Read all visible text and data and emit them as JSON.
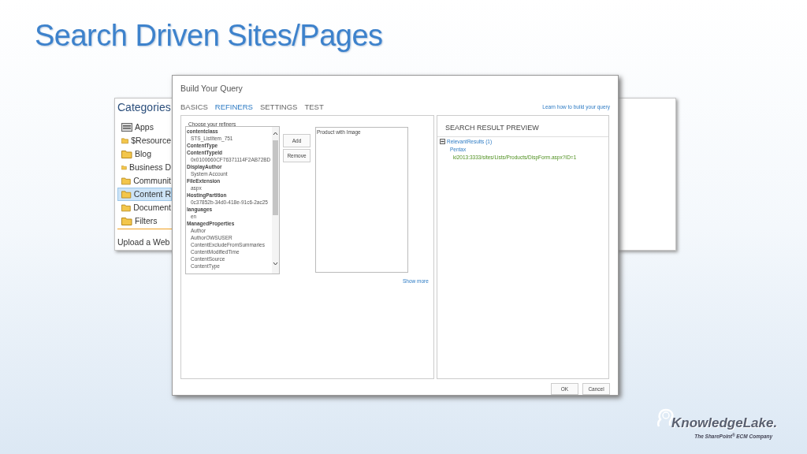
{
  "slide_title": "Search Driven Sites/Pages",
  "categories_panel": {
    "title": "Categories",
    "items": [
      {
        "label": "Apps",
        "kind": "app",
        "selected": false
      },
      {
        "label": "$Resource",
        "kind": "folder",
        "selected": false
      },
      {
        "label": "Blog",
        "kind": "folder",
        "selected": false
      },
      {
        "label": "Business D",
        "kind": "folder",
        "selected": false
      },
      {
        "label": "Communit",
        "kind": "folder",
        "selected": false
      },
      {
        "label": "Content R",
        "kind": "folder",
        "selected": true
      },
      {
        "label": "Document",
        "kind": "folder",
        "selected": false
      },
      {
        "label": "Filters",
        "kind": "folder",
        "selected": false
      }
    ],
    "footer": "Upload a Web"
  },
  "dialog": {
    "title": "Build Your Query",
    "tabs": [
      {
        "label": "BASICS",
        "selected": false
      },
      {
        "label": "REFINERS",
        "selected": true
      },
      {
        "label": "SETTINGS",
        "selected": false
      },
      {
        "label": "TEST",
        "selected": false
      }
    ],
    "help_link": "Learn how to build your query",
    "refiners_label": "Choose your refiners",
    "refiners": [
      {
        "name": "contentclass",
        "children": [
          {
            "label": "STS_ListItem_751"
          }
        ]
      },
      {
        "name": "ContentType"
      },
      {
        "name": "ContentTypeId",
        "children": [
          {
            "label": "0x0100660CF76371114F2AB72BD"
          }
        ]
      },
      {
        "name": "DisplayAuthor",
        "children": [
          {
            "label": "System Account"
          }
        ]
      },
      {
        "name": "FileExtension",
        "children": [
          {
            "label": "aspx"
          }
        ]
      },
      {
        "name": "HostingPartition",
        "children": [
          {
            "label": "0c37852b-34d0-418e-91c6-2ac25"
          }
        ]
      },
      {
        "name": "languages",
        "children": [
          {
            "label": "en"
          }
        ]
      },
      {
        "name": "ManagedProperties",
        "children": [
          {
            "label": "Author"
          },
          {
            "label": "AuthorOWSUSER"
          },
          {
            "label": "ContentExcludeFromSummaries"
          },
          {
            "label": "ContentModifiedTime"
          },
          {
            "label": "ContentSource"
          },
          {
            "label": "ContentType"
          }
        ]
      }
    ],
    "add_button": "Add",
    "remove_button": "Remove",
    "selected_refiners": [
      "Product with Image"
    ],
    "show_more": "Show more",
    "preview": {
      "title": "SEARCH RESULT PREVIEW",
      "tree": [
        {
          "label": "RelevantResults (1)",
          "expanded": true,
          "children": [
            {
              "label": "Pentax",
              "url": "ki2013:3333/sites/Lists/Products/DispForm.aspx?ID=1"
            }
          ]
        }
      ]
    },
    "ok_button": "OK",
    "cancel_button": "Cancel"
  },
  "logo": {
    "name": "KnowledgeLake.",
    "tagline": "The SharePoint$^{®}$ ECM Company"
  }
}
